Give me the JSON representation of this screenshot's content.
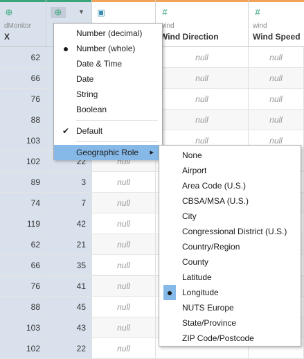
{
  "columns": [
    {
      "source": "dMonitor",
      "name": "X",
      "icon": "globe-icon"
    },
    {
      "source": "",
      "name": "",
      "icon": "globe-icon"
    },
    {
      "source": "",
      "name": "",
      "icon": "calendar-icon"
    },
    {
      "source": "wind",
      "name": "Wind Direction",
      "icon": "hash-icon"
    },
    {
      "source": "wind",
      "name": "Wind Speed",
      "icon": "hash-icon"
    }
  ],
  "rows": [
    {
      "x": "62",
      "y": "",
      "c3": "",
      "wd": "null",
      "ws": "null"
    },
    {
      "x": "66",
      "y": "",
      "c3": "",
      "wd": "null",
      "ws": "null"
    },
    {
      "x": "76",
      "y": "",
      "c3": "",
      "wd": "null",
      "ws": "null"
    },
    {
      "x": "88",
      "y": "",
      "c3": "",
      "wd": "null",
      "ws": "null"
    },
    {
      "x": "103",
      "y": "",
      "c3": "",
      "wd": "null",
      "ws": "null"
    },
    {
      "x": "102",
      "y": "22",
      "c3": "null",
      "wd": "",
      "ws": ""
    },
    {
      "x": "89",
      "y": "3",
      "c3": "null",
      "wd": "",
      "ws": ""
    },
    {
      "x": "74",
      "y": "7",
      "c3": "null",
      "wd": "",
      "ws": ""
    },
    {
      "x": "119",
      "y": "42",
      "c3": "null",
      "wd": "",
      "ws": ""
    },
    {
      "x": "62",
      "y": "21",
      "c3": "null",
      "wd": "",
      "ws": ""
    },
    {
      "x": "66",
      "y": "35",
      "c3": "null",
      "wd": "",
      "ws": ""
    },
    {
      "x": "76",
      "y": "41",
      "c3": "null",
      "wd": "",
      "ws": ""
    },
    {
      "x": "88",
      "y": "45",
      "c3": "null",
      "wd": "",
      "ws": ""
    },
    {
      "x": "103",
      "y": "43",
      "c3": "null",
      "wd": "",
      "ws": ""
    },
    {
      "x": "102",
      "y": "22",
      "c3": "null",
      "wd": "",
      "ws": ""
    }
  ],
  "context_menu": {
    "items": [
      {
        "label": "Number (decimal)",
        "mark": ""
      },
      {
        "label": "Number (whole)",
        "mark": "dot"
      },
      {
        "label": "Date & Time",
        "mark": ""
      },
      {
        "label": "Date",
        "mark": ""
      },
      {
        "label": "String",
        "mark": ""
      },
      {
        "label": "Boolean",
        "mark": ""
      },
      {
        "label": "Default",
        "mark": "check"
      },
      {
        "label": "Geographic Role",
        "mark": "",
        "submenu_arrow": "▸"
      }
    ]
  },
  "geo_submenu": {
    "items": [
      {
        "label": "None"
      },
      {
        "label": "Airport"
      },
      {
        "label": "Area Code (U.S.)"
      },
      {
        "label": "CBSA/MSA (U.S.)"
      },
      {
        "label": "City"
      },
      {
        "label": "Congressional District (U.S.)"
      },
      {
        "label": "Country/Region"
      },
      {
        "label": "County"
      },
      {
        "label": "Latitude"
      },
      {
        "label": "Longitude",
        "selected": true
      },
      {
        "label": "NUTS Europe"
      },
      {
        "label": "State/Province"
      },
      {
        "label": "ZIP Code/Postcode"
      }
    ]
  },
  "colors": {
    "accent_green": "#3aa57a",
    "accent_orange": "#f0a25a",
    "highlight": "#86b9e8",
    "column_selected": "#d8e1ec"
  }
}
